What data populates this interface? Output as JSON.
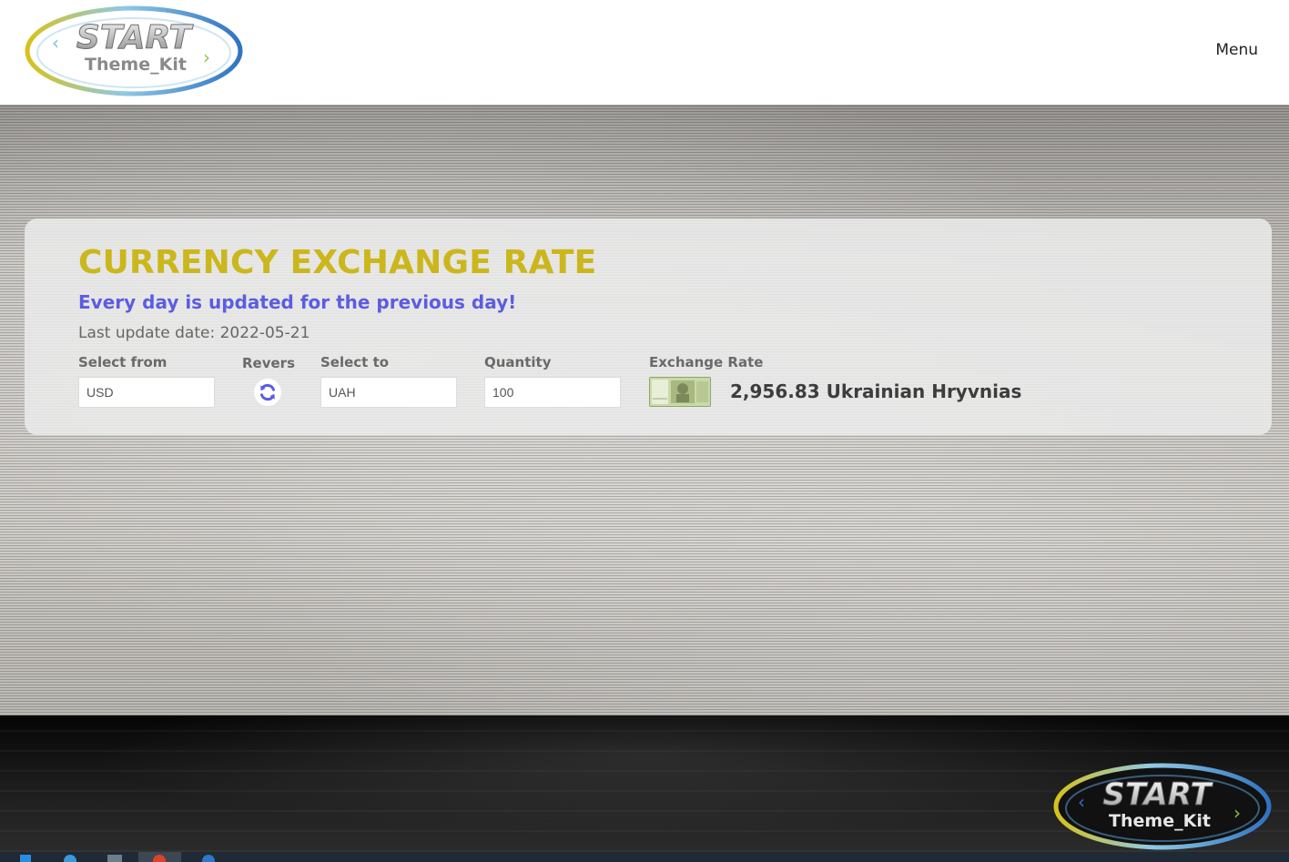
{
  "header": {
    "logo": {
      "word1": "START",
      "word2": "Theme_Kit"
    },
    "menu_label": "Menu"
  },
  "card": {
    "title": "CURRENCY EXCHANGE RATE",
    "subtitle": "Every day is updated for the previous day!",
    "last_update_label": "Last update date:",
    "last_update_value": "2022-05-21",
    "fields": {
      "from_label": "Select from",
      "from_value": "USD",
      "revers_label": "Revers",
      "to_label": "Select to",
      "to_value": "UAH",
      "quantity_label": "Quantity",
      "quantity_value": "100",
      "rate_label": "Exchange Rate"
    },
    "result": "2,956.83 Ukrainian Hryvnias"
  },
  "footer": {
    "logo": {
      "word1": "START",
      "word2": "Theme_Kit"
    }
  },
  "colors": {
    "title": "#cbb71c",
    "subtitle": "#5b5de0",
    "revers_icon": "#5b5de0"
  },
  "icons": {
    "revers": "refresh-icon",
    "banknote": "banknote-icon"
  }
}
